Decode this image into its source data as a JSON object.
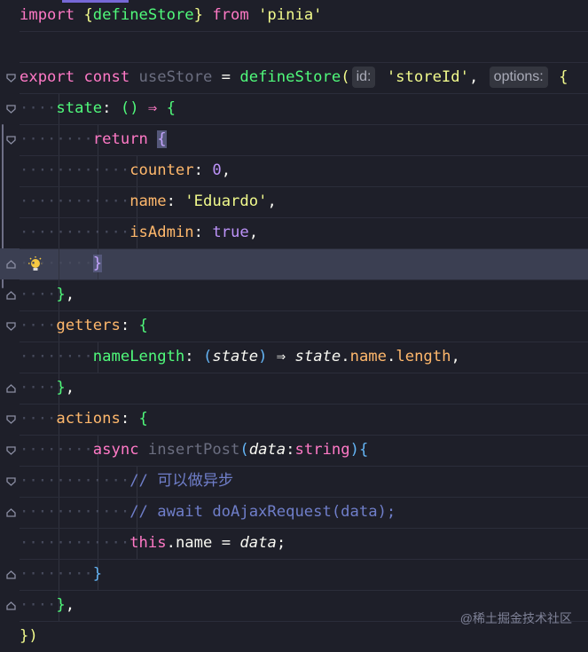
{
  "editor": {
    "watermark": "@稀土掘金技术社区",
    "lines": [
      {
        "tokens": [
          [
            "import ",
            "k-pink"
          ],
          [
            "{",
            "k-brace-y"
          ],
          [
            "defineStore",
            "k-green"
          ],
          [
            "}",
            "k-brace-y"
          ],
          [
            " from ",
            "k-pink"
          ],
          [
            "'pinia'",
            "k-str"
          ]
        ]
      },
      {
        "tokens": []
      },
      {
        "fold": "open",
        "tokens": [
          [
            "export ",
            "k-pink"
          ],
          [
            "const ",
            "k-pink"
          ],
          [
            "useStore",
            "k-gray"
          ],
          [
            " = ",
            "k-white"
          ],
          [
            "defineStore",
            "k-green"
          ],
          [
            "(",
            "k-brace-y"
          ],
          [
            "id:",
            "hint"
          ],
          [
            " ",
            "k-white"
          ],
          [
            "'storeId'",
            "k-str"
          ],
          [
            ", ",
            "k-white"
          ],
          [
            "options:",
            "hint"
          ],
          [
            " ",
            "k-white"
          ],
          [
            "{",
            "k-brace-y"
          ]
        ]
      },
      {
        "fold": "open",
        "indent": 1,
        "tokens": [
          [
            "state",
            "k-green"
          ],
          [
            ": ",
            "k-white"
          ],
          [
            "() ",
            "k-green"
          ],
          [
            "⇒ ",
            "k-pink"
          ],
          [
            "{",
            "k-green"
          ]
        ]
      },
      {
        "fold": "open",
        "indent": 2,
        "tokens": [
          [
            "return ",
            "k-pink"
          ],
          [
            "{",
            "hl-brace"
          ]
        ]
      },
      {
        "indent": 3,
        "tokens": [
          [
            "counter",
            "k-orange"
          ],
          [
            ": ",
            "k-white"
          ],
          [
            "0",
            "k-purple"
          ],
          [
            ",",
            "k-white"
          ]
        ]
      },
      {
        "indent": 3,
        "tokens": [
          [
            "name",
            "k-orange"
          ],
          [
            ": ",
            "k-white"
          ],
          [
            "'Eduardo'",
            "k-str"
          ],
          [
            ",",
            "k-white"
          ]
        ]
      },
      {
        "indent": 3,
        "tokens": [
          [
            "isAdmin",
            "k-orange"
          ],
          [
            ": ",
            "k-white"
          ],
          [
            "true",
            "k-purple"
          ],
          [
            ",",
            "k-white"
          ]
        ]
      },
      {
        "fold": "close",
        "cur": true,
        "bulb": true,
        "indent": 2,
        "tokens": [
          [
            "}",
            "hl-brace"
          ]
        ]
      },
      {
        "fold": "close",
        "indent": 1,
        "tokens": [
          [
            "}",
            "k-green"
          ],
          [
            ",",
            "k-white"
          ]
        ]
      },
      {
        "fold": "open",
        "indent": 1,
        "tokens": [
          [
            "getters",
            "k-orange"
          ],
          [
            ": ",
            "k-white"
          ],
          [
            "{",
            "k-green"
          ]
        ]
      },
      {
        "indent": 2,
        "tokens": [
          [
            "nameLength",
            "k-green"
          ],
          [
            ": ",
            "k-white"
          ],
          [
            "(",
            "k-brace-b"
          ],
          [
            "state",
            "k-italic k-white"
          ],
          [
            ") ",
            "k-brace-b"
          ],
          [
            "⇒ ",
            "k-white"
          ],
          [
            "state",
            "k-italic k-white"
          ],
          [
            ".",
            "k-white"
          ],
          [
            "name",
            "k-orange"
          ],
          [
            ".",
            "k-white"
          ],
          [
            "length",
            "k-orange"
          ],
          [
            ",",
            "k-white"
          ]
        ]
      },
      {
        "fold": "close",
        "indent": 1,
        "tokens": [
          [
            "}",
            "k-green"
          ],
          [
            ",",
            "k-white"
          ]
        ]
      },
      {
        "fold": "open",
        "indent": 1,
        "tokens": [
          [
            "actions",
            "k-orange"
          ],
          [
            ": ",
            "k-white"
          ],
          [
            "{",
            "k-green"
          ]
        ]
      },
      {
        "fold": "open",
        "indent": 2,
        "tokens": [
          [
            "async ",
            "k-pink"
          ],
          [
            "insertPost",
            "k-gray"
          ],
          [
            "(",
            "k-brace-b"
          ],
          [
            "data",
            "k-italic k-white"
          ],
          [
            ":",
            "k-white"
          ],
          [
            "string",
            "k-pink"
          ],
          [
            ")",
            "k-brace-b"
          ],
          [
            "{",
            "k-brace-b"
          ]
        ]
      },
      {
        "fold": "open",
        "indent": 3,
        "tokens": [
          [
            "// 可以做异步",
            "k-comment"
          ]
        ]
      },
      {
        "fold": "close",
        "indent": 3,
        "tokens": [
          [
            "// await doAjaxRequest(data);",
            "k-comment"
          ]
        ]
      },
      {
        "indent": 3,
        "tokens": [
          [
            "this",
            "k-pink"
          ],
          [
            ".",
            "k-white"
          ],
          [
            "name",
            "k-white"
          ],
          [
            " = ",
            "k-white"
          ],
          [
            "data",
            "k-italic k-white"
          ],
          [
            ";",
            "k-white"
          ]
        ]
      },
      {
        "fold": "close",
        "indent": 2,
        "tokens": [
          [
            "}",
            "k-brace-b"
          ]
        ]
      },
      {
        "fold": "close",
        "indent": 1,
        "tokens": [
          [
            "}",
            "k-green"
          ],
          [
            ",",
            "k-white"
          ]
        ]
      },
      {
        "tokens": [
          [
            "})",
            "k-brace-y"
          ]
        ]
      }
    ]
  }
}
